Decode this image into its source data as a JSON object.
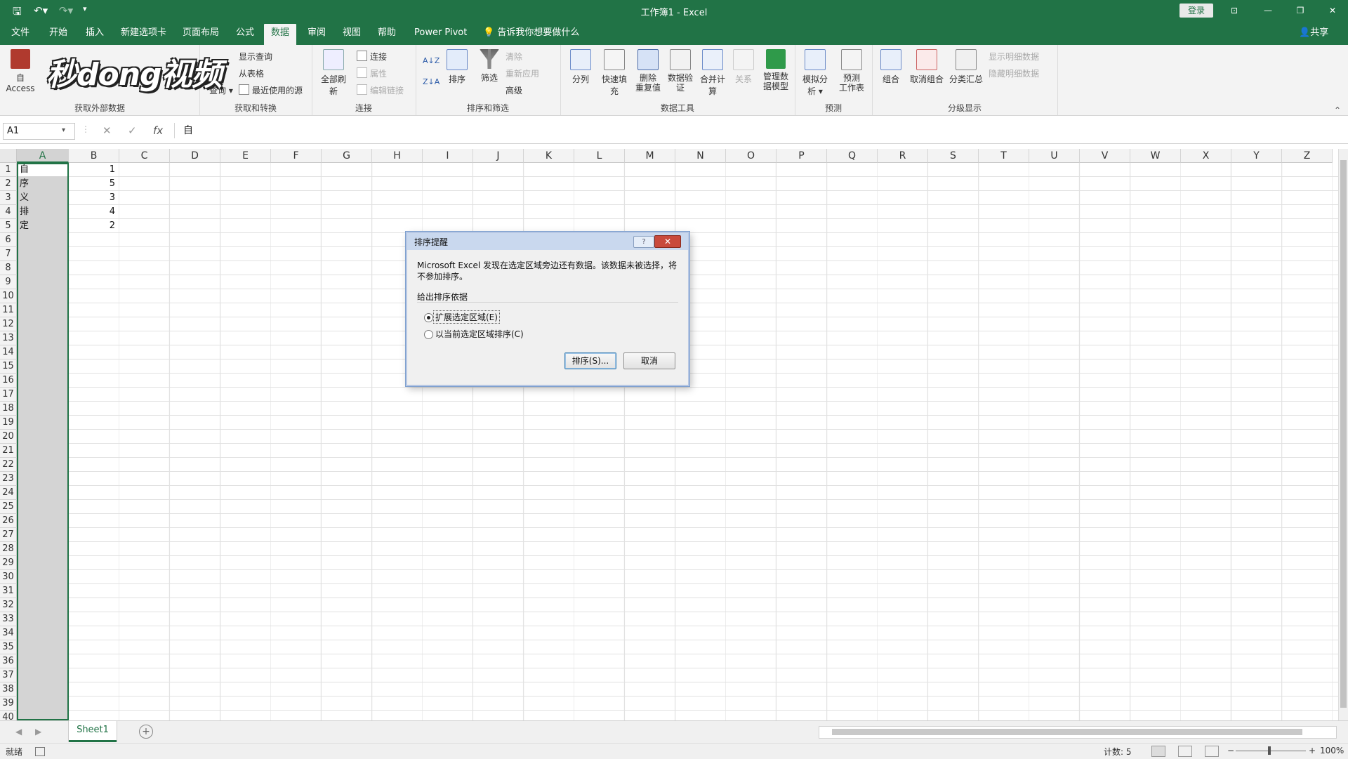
{
  "window": {
    "title": "工作簿1 - Excel",
    "login_label": "登录",
    "share_label": "共享",
    "win_buttons": [
      "⊡",
      "—",
      "❐",
      "✕"
    ]
  },
  "qat": {
    "save_icon": "save-icon",
    "undo_icon": "undo-icon",
    "redo_icon": "redo-icon"
  },
  "tabs": [
    "文件",
    "开始",
    "插入",
    "新建选项卡",
    "页面布局",
    "公式",
    "数据",
    "审阅",
    "视图",
    "帮助",
    "Power Pivot"
  ],
  "active_tab": "数据",
  "tell_me": "告诉我你想要做什么",
  "watermark": "秒dong视频",
  "ribbon": {
    "external": {
      "label": "获取外部数据",
      "access": "自 Access"
    },
    "transform": {
      "label": "获取和转换",
      "show_query": "显示查询",
      "from_table": "从表格",
      "recent": "最近使用的源",
      "new_query": "查询"
    },
    "connections": {
      "label": "连接",
      "refresh_all": "全部刷新",
      "connections": "连接",
      "properties": "属性",
      "edit_links": "编辑链接"
    },
    "sortfilter": {
      "label": "排序和筛选",
      "sort": "排序",
      "filter": "筛选",
      "clear": "清除",
      "reapply": "重新应用",
      "advanced": "高级"
    },
    "datatools": {
      "label": "数据工具",
      "split": "分列",
      "flash": "快速填充",
      "dedupe": "删除\n重复值",
      "validate": "数据验\n证",
      "consolidate": "合并计算",
      "relations": "关系",
      "model": "管理数\n据模型"
    },
    "forecast": {
      "label": "预测",
      "whatif": "模拟分析",
      "sheet": "预测\n工作表"
    },
    "outline": {
      "label": "分级显示",
      "group": "组合",
      "ungroup": "取消组合",
      "subtotal": "分类汇总",
      "show_detail": "显示明细数据",
      "hide_detail": "隐藏明细数据"
    }
  },
  "formula_bar": {
    "name_box": "A1",
    "cancel": "✕",
    "enter": "✓",
    "fx": "fx",
    "content": "自"
  },
  "grid": {
    "columns": [
      "A",
      "B",
      "C",
      "D",
      "E",
      "F",
      "G",
      "H",
      "I",
      "J",
      "K",
      "L",
      "M",
      "N",
      "O",
      "P",
      "Q",
      "R",
      "S",
      "T",
      "U",
      "V",
      "W",
      "X",
      "Y",
      "Z"
    ],
    "row_count": 40,
    "cells": [
      {
        "ref": "A1",
        "col": 0,
        "row": 0,
        "value": "自",
        "align": "left"
      },
      {
        "ref": "A2",
        "col": 0,
        "row": 1,
        "value": "序",
        "align": "left"
      },
      {
        "ref": "A3",
        "col": 0,
        "row": 2,
        "value": "义",
        "align": "left"
      },
      {
        "ref": "A4",
        "col": 0,
        "row": 3,
        "value": "排",
        "align": "left"
      },
      {
        "ref": "A5",
        "col": 0,
        "row": 4,
        "value": "定",
        "align": "left"
      },
      {
        "ref": "B1",
        "col": 1,
        "row": 0,
        "value": "1",
        "align": "right"
      },
      {
        "ref": "B2",
        "col": 1,
        "row": 1,
        "value": "5",
        "align": "right"
      },
      {
        "ref": "B3",
        "col": 1,
        "row": 2,
        "value": "3",
        "align": "right"
      },
      {
        "ref": "B4",
        "col": 1,
        "row": 3,
        "value": "4",
        "align": "right"
      },
      {
        "ref": "B5",
        "col": 1,
        "row": 4,
        "value": "2",
        "align": "right"
      }
    ],
    "selected_column": "A"
  },
  "sheets": {
    "tabs": [
      "Sheet1"
    ],
    "active": "Sheet1",
    "add_icon": "plus-circle-icon"
  },
  "status": {
    "ready": "就绪",
    "count": "计数: 5",
    "zoom": "100%"
  },
  "dialog": {
    "title": "排序提醒",
    "help": "?",
    "close": "✕",
    "message": "Microsoft Excel 发现在选定区域旁边还有数据。该数据未被选择，将不参加排序。",
    "section": "给出排序依据",
    "option_expand": "扩展选定区域(E)",
    "option_current": "以当前选定区域排序(C)",
    "selected_option": "expand",
    "sort_button": "排序(S)...",
    "cancel_button": "取消"
  }
}
